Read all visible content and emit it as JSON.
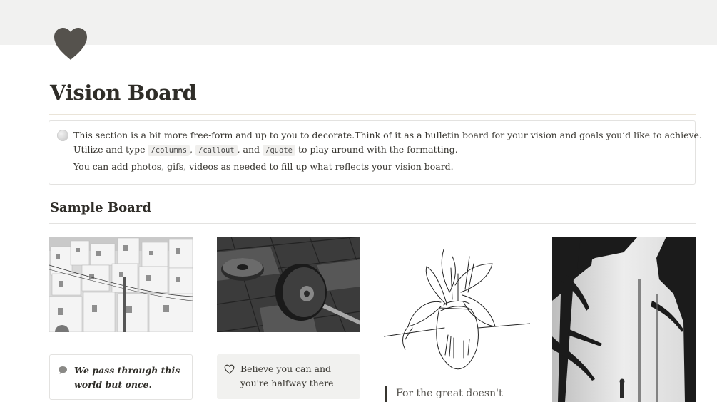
{
  "page": {
    "icon": "heart-icon",
    "title": "Vision Board"
  },
  "callout": {
    "icon": "moon-icon",
    "line1": "This section is a bit more free-form and up to you to decorate.Think of it as a bulletin board for your vision and goals you’d like to achieve.",
    "line2_prefix": "Utilize and type",
    "code1": "/columns",
    "sep1": ",",
    "code2": "/callout",
    "sep2": ", and",
    "code3": "/quote",
    "line2_suffix": "to play around with the formatting.",
    "line3": "You can add photos, gifs, videos as needed to fill up what reflects your vision board."
  },
  "section": {
    "heading": "Sample Board"
  },
  "board": {
    "callout1": {
      "icon": "speech-bubble-icon",
      "text": "We pass through this world but once."
    },
    "callout2": {
      "icon": "heart-outline-icon",
      "text": "Believe you can and you're halfway there"
    },
    "quote": {
      "text": "For the great doesn't"
    }
  },
  "colors": {
    "cover": "#f1f1f0",
    "icon": "#55524d",
    "text": "#37352f",
    "callout_bg": "#f1f1ef"
  }
}
